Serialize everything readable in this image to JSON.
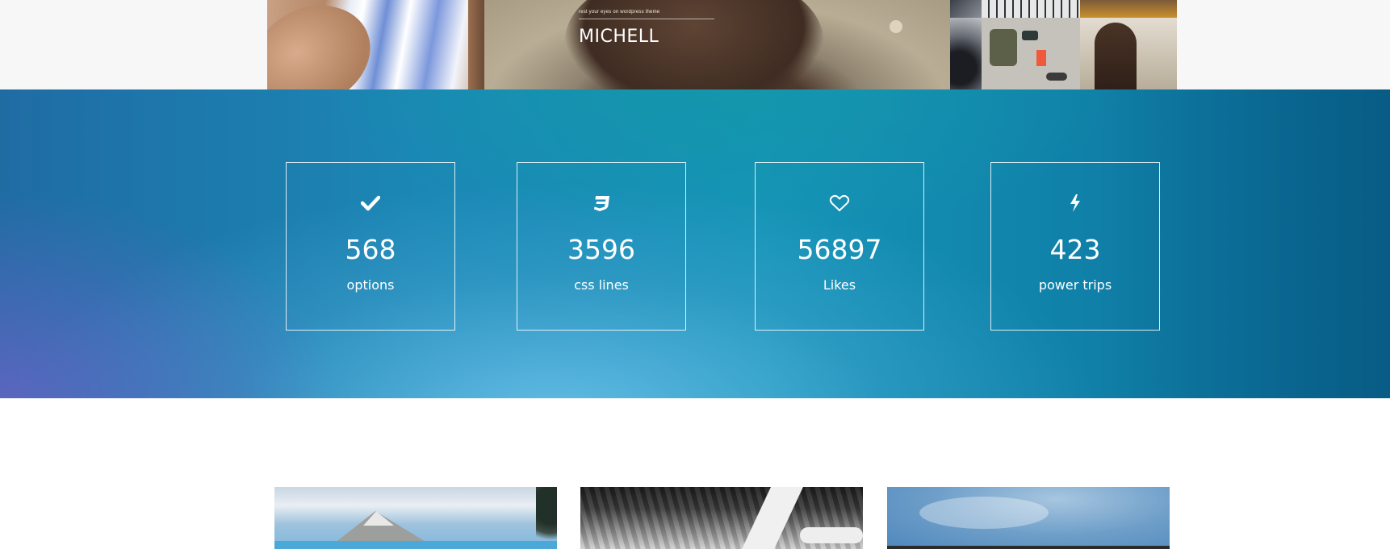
{
  "featured_post": {
    "tagline": "rest your eyes on wordpress theme",
    "title": "MICHELL"
  },
  "stats": [
    {
      "icon": "check-icon",
      "value": "568",
      "label": "options"
    },
    {
      "icon": "css3-icon",
      "value": "3596",
      "label": "css lines"
    },
    {
      "icon": "heart-icon",
      "value": "56897",
      "label": "Likes"
    },
    {
      "icon": "bolt-icon",
      "value": "423",
      "label": "power trips"
    }
  ],
  "colors": {
    "band_teal": "#1594b8",
    "band_blue": "#1f6ca3",
    "text_white": "#ffffff"
  }
}
